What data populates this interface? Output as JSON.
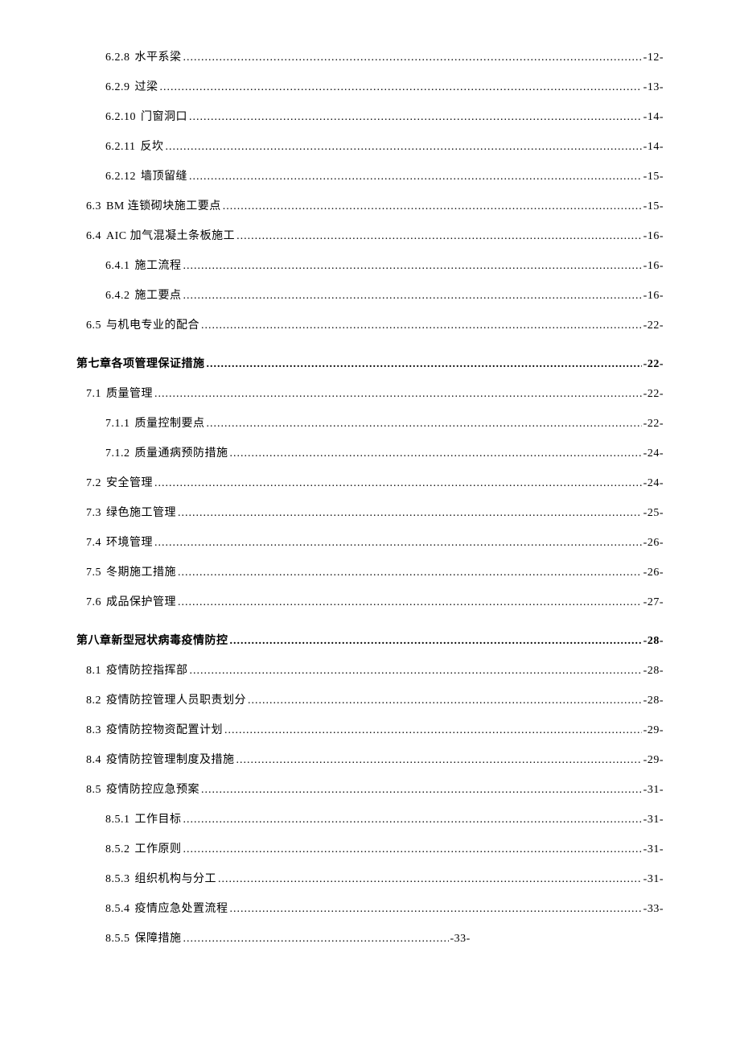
{
  "entries": [
    {
      "level": 3,
      "number": "6.2.8",
      "title": "水平系梁",
      "page": "-12-"
    },
    {
      "level": 3,
      "number": "6.2.9",
      "title": "过梁",
      "page": "-13-"
    },
    {
      "level": 3,
      "number": "6.2.10",
      "title": "门窗洞口",
      "page": "-14-"
    },
    {
      "level": 3,
      "number": "6.2.11",
      "title": "反坎",
      "page": "-14-"
    },
    {
      "level": 3,
      "number": "6.2.12",
      "title": "墙顶留缝",
      "page": "-15-"
    },
    {
      "level": 2,
      "number": "6.3",
      "title": "BM 连锁砌块施工要点",
      "page": "-15-"
    },
    {
      "level": 2,
      "number": "6.4",
      "title": "AIC 加气混凝土条板施工",
      "page": "-16-"
    },
    {
      "level": 3,
      "number": "6.4.1",
      "title": "施工流程",
      "page": "-16-"
    },
    {
      "level": 3,
      "number": "6.4.2",
      "title": "施工要点",
      "page": "-16-"
    },
    {
      "level": 2,
      "number": "6.5",
      "title": "与机电专业的配合",
      "page": "-22-"
    },
    {
      "level": 0,
      "number": "",
      "title": "第七章各项管理保证措施",
      "page": "-22-"
    },
    {
      "level": 2,
      "number": "7.1",
      "title": "质量管理",
      "page": "-22-"
    },
    {
      "level": 3,
      "number": "7.1.1",
      "title": "质量控制要点",
      "page": "-22-"
    },
    {
      "level": 3,
      "number": "7.1.2",
      "title": "质量通病预防措施",
      "page": "-24-"
    },
    {
      "level": 2,
      "number": "7.2",
      "title": "安全管理",
      "page": "-24-"
    },
    {
      "level": 2,
      "number": "7.3",
      "title": "绿色施工管理",
      "page": "-25-"
    },
    {
      "level": 2,
      "number": "7.4",
      "title": "环境管理",
      "page": "-26-"
    },
    {
      "level": 2,
      "number": "7.5",
      "title": "冬期施工措施",
      "page": "-26-"
    },
    {
      "level": 2,
      "number": "7.6",
      "title": "成品保护管理",
      "page": "-27-"
    },
    {
      "level": 0,
      "number": "",
      "title": "第八章新型冠状病毒疫情防控",
      "page": "-28-"
    },
    {
      "level": 2,
      "number": "8.1",
      "title": "疫情防控指挥部",
      "page": "-28-"
    },
    {
      "level": 2,
      "number": "8.2",
      "title": "疫情防控管理人员职责划分",
      "page": "-28-"
    },
    {
      "level": 2,
      "number": "8.3",
      "title": "疫情防控物资配置计划",
      "page": "-29-"
    },
    {
      "level": 2,
      "number": "8.4",
      "title": "疫情防控管理制度及措施",
      "page": "-29-"
    },
    {
      "level": 2,
      "number": "8.5",
      "title": "疫情防控应急预案",
      "page": "-31-"
    },
    {
      "level": 3,
      "number": "8.5.1",
      "title": "工作目标",
      "page": "-31-"
    },
    {
      "level": 3,
      "number": "8.5.2",
      "title": "工作原则",
      "page": "-31-"
    },
    {
      "level": 3,
      "number": "8.5.3",
      "title": "组织机构与分工",
      "page": "-31-"
    },
    {
      "level": 3,
      "number": "8.5.4",
      "title": "疫情应急处置流程",
      "page": "-33-"
    },
    {
      "level": 3,
      "number": "8.5.5",
      "title": "保障措施",
      "page": "-33-",
      "short": true
    }
  ]
}
